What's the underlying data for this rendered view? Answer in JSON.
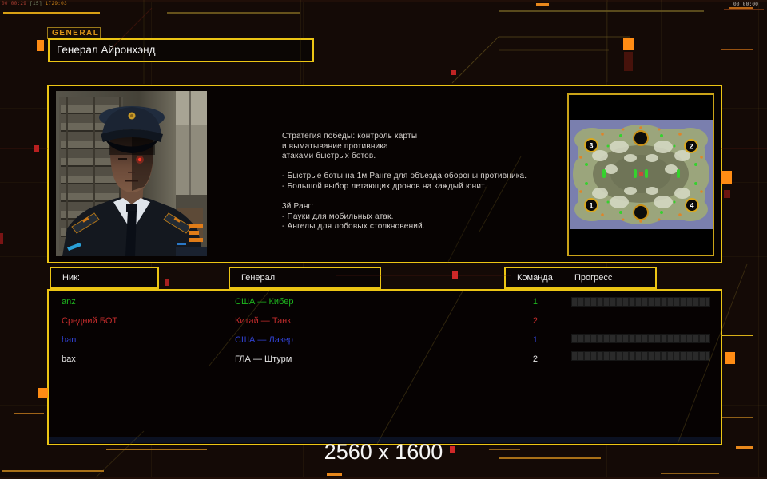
{
  "osd": {
    "left_time": "00 00:29",
    "left_mid": "[15]",
    "left_counter": "1729:03",
    "right_time": "00:00:00"
  },
  "tag": {
    "label": "GENERAL"
  },
  "title": "Генерал Айронхэнд",
  "strategy": {
    "lines": [
      "Стратегия победы: контроль карты",
      "и выматывание противника",
      "атаками быстрых ботов.",
      "",
      "- Быстрые боты на 1м Ранге для объезда обороны противника.",
      "- Большой выбор летающих дронов на каждый юнит.",
      "",
      "3й Ранг:",
      "- Пауки для мобильных атак.",
      "- Ангелы для лобовых столкновений."
    ]
  },
  "minimap": {
    "spots": [
      {
        "label": "3"
      },
      {
        "label": "2"
      },
      {
        "label": "1"
      },
      {
        "label": "4"
      }
    ]
  },
  "table": {
    "headers": {
      "nick": "Ник:",
      "general": "Генерал",
      "team": "Команда",
      "progress": "Прогресс"
    },
    "rows": [
      {
        "nick": "anz",
        "general": "США — Кибер",
        "team": "1",
        "color": "#1eb41e"
      },
      {
        "nick": "Средний БОТ",
        "general": "Китай — Танк",
        "team": "2",
        "color": "#c22c2c"
      },
      {
        "nick": "han",
        "general": "США — Лазер",
        "team": "1",
        "color": "#3142d2"
      },
      {
        "nick": "bax",
        "general": "ГЛА — Штурм",
        "team": "2",
        "color": "#e6e6e6"
      }
    ]
  },
  "footer": {
    "resolution": "2560 x 1600"
  },
  "colors": {
    "accent_yellow": "#ecc514",
    "accent_orange": "#ff8c14",
    "accent_red": "#c02424"
  }
}
